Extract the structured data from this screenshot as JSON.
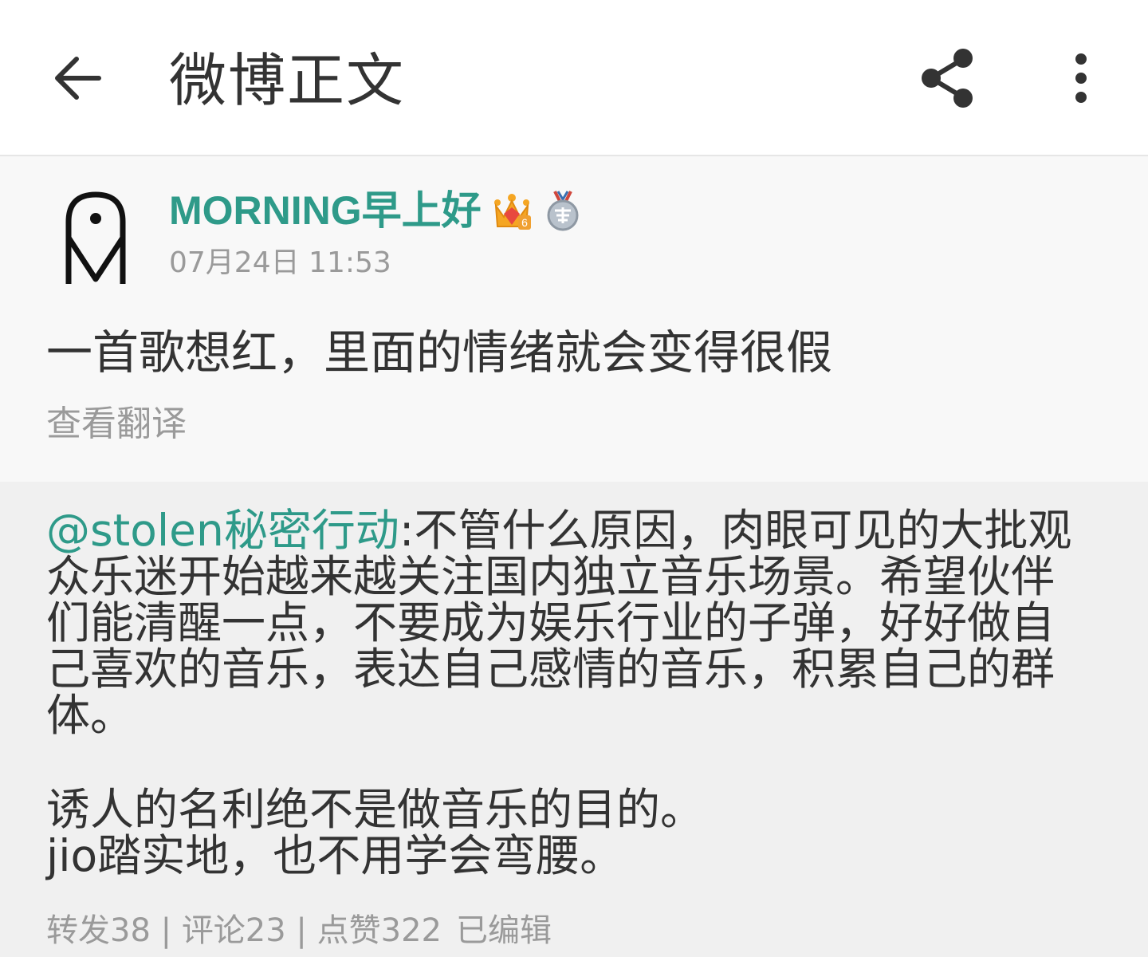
{
  "header": {
    "title": "微博正文",
    "back_icon": "arrow-left-icon",
    "share_icon": "share-icon",
    "more_icon": "more-vertical-icon"
  },
  "post": {
    "username": "MORNING早上好",
    "badges": [
      "crown-badge-icon",
      "medal-badge-icon"
    ],
    "timestamp": "07月24日 11:53",
    "text": "一首歌想红，里面的情绪就会变得很假",
    "translate_label": "查看翻译"
  },
  "repost": {
    "mention": "@stolen秘密行动",
    "body": ":不管什么原因，肉眼可见的大批观众乐迷开始越来越关注国内独立音乐场景。希望伙伴们能清醒一点，不要成为娱乐行业的子弹，好好做自己喜欢的音乐，表达自己感情的音乐，积累自己的群体。",
    "line2": "诱人的名利绝不是做音乐的目的。",
    "line3": "jio踏实地，也不用学会弯腰。",
    "forward": "转发38",
    "comment": "评论23",
    "like": "点赞322",
    "edited": "已编辑",
    "separator": " | "
  },
  "colors": {
    "accent": "#2e9a89",
    "text": "#333333",
    "muted": "#9a9a9a",
    "post_bg": "#f8f8f8",
    "repost_bg": "#f0f0f0"
  }
}
